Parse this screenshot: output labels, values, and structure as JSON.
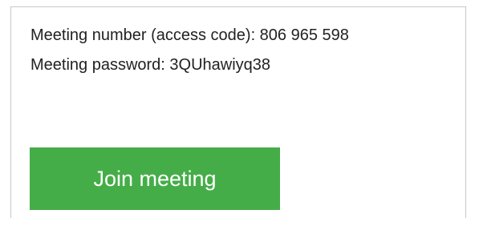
{
  "meeting": {
    "number_line": "Meeting number (access code): 806 965 598",
    "password_line": "Meeting password: 3QUhawiyq38",
    "join_label": "Join meeting",
    "join_color": "#45ad48"
  }
}
